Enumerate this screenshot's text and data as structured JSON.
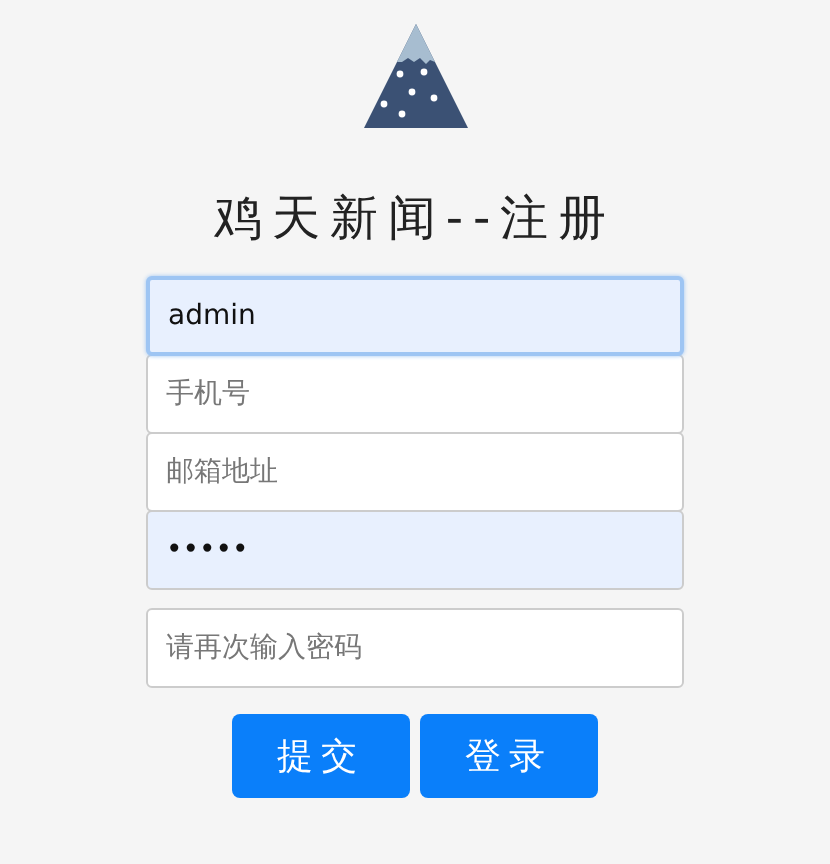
{
  "title": "鸡天新闻--注册",
  "fields": [
    {
      "value": "admin",
      "autofilled": true,
      "focused": true
    },
    {
      "placeholder": "手机号",
      "autofilled": false,
      "focused": false
    },
    {
      "placeholder": "邮箱地址",
      "autofilled": false,
      "focused": false
    },
    {
      "value": "•••••",
      "autofilled": true,
      "focused": false
    },
    {
      "placeholder": "请再次输入密码",
      "autofilled": false,
      "focused": false
    }
  ],
  "buttons": [
    "提交",
    "登录"
  ]
}
